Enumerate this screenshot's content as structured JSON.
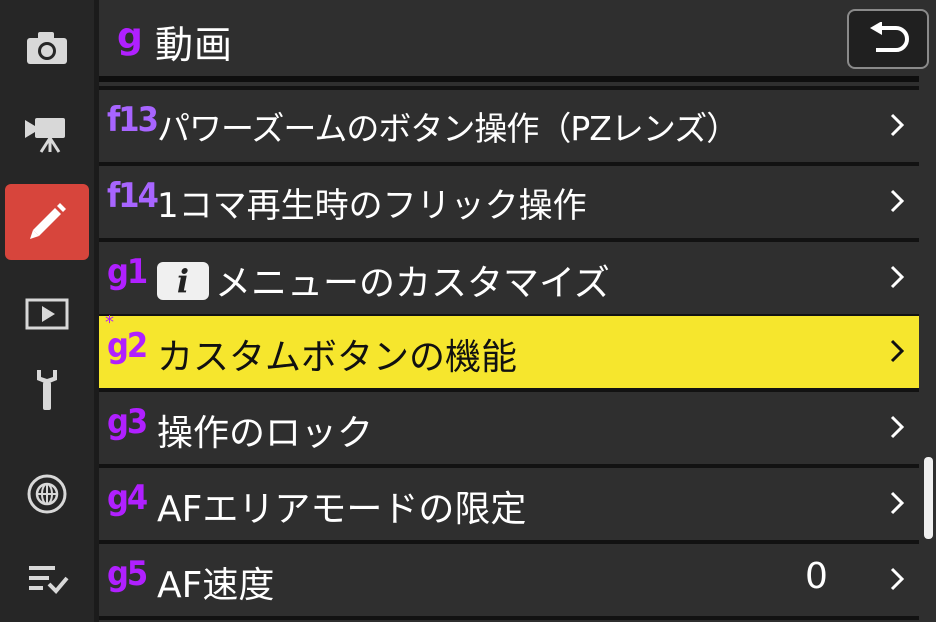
{
  "header": {
    "menu_code": "g",
    "title": "動画",
    "back_icon": "return-arrow-icon"
  },
  "sidebar": {
    "items": [
      {
        "name": "camera-icon",
        "active": false
      },
      {
        "name": "movie-camera-icon",
        "active": false
      },
      {
        "name": "pencil-icon",
        "active": true
      },
      {
        "name": "playback-icon",
        "active": false
      },
      {
        "name": "wrench-icon",
        "active": false
      },
      {
        "name": "network-icon",
        "active": false
      },
      {
        "name": "my-menu-icon",
        "active": false
      }
    ]
  },
  "menu": {
    "rows": [
      {
        "code": "f13",
        "label": "パワーズームのボタン操作（PZレンズ）",
        "value": "",
        "selected": false
      },
      {
        "code": "f14",
        "label": "1コマ再生時のフリック操作",
        "value": "",
        "selected": false
      },
      {
        "code": "g1",
        "label": "メニューのカスタマイズ",
        "badge": "i",
        "value": "",
        "selected": false
      },
      {
        "code": "g2",
        "label": "カスタムボタンの機能",
        "value": "",
        "selected": true,
        "marker": "*"
      },
      {
        "code": "g3",
        "label": "操作のロック",
        "value": "",
        "selected": false
      },
      {
        "code": "g4",
        "label": "AFエリアモードの限定",
        "value": "",
        "selected": false
      },
      {
        "code": "g5",
        "label": "AF速度",
        "value": "0",
        "selected": false
      }
    ]
  },
  "colors": {
    "accent": "#b020ff",
    "selected_row": "#f6e62d",
    "active_tab": "#d7453c",
    "background": "#2f2f2f"
  }
}
